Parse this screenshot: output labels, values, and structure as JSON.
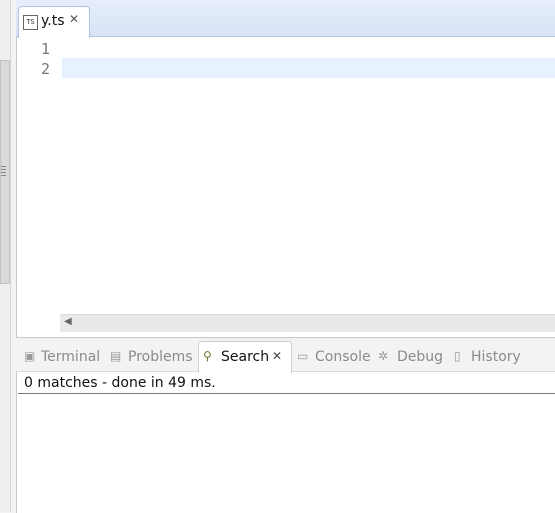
{
  "editor": {
    "tab": {
      "icon": "typescript-file-icon",
      "icon_text": "TS",
      "label": "y.ts",
      "close": "✕"
    },
    "line_numbers": [
      "1",
      "2"
    ]
  },
  "views": {
    "tabs": [
      {
        "label": "Terminal",
        "icon": "terminal-icon",
        "glyph": "▣"
      },
      {
        "label": "Problems",
        "icon": "problems-icon",
        "glyph": "▤"
      },
      {
        "label": "Search",
        "icon": "search-flashlight-icon",
        "glyph": "⚲",
        "active": true
      },
      {
        "label": "Console",
        "icon": "console-icon",
        "glyph": "▭"
      },
      {
        "label": "Debug",
        "icon": "debug-bug-icon",
        "glyph": "✲"
      },
      {
        "label": "History",
        "icon": "history-icon",
        "glyph": "▯"
      }
    ],
    "search_close": "✕",
    "search_status": "0 matches - done in 49 ms."
  },
  "colors": {
    "editor_tabbar": "#dde7f7",
    "current_line": "#e8f2fe",
    "inactive_tab_text": "#8a8a8a"
  }
}
